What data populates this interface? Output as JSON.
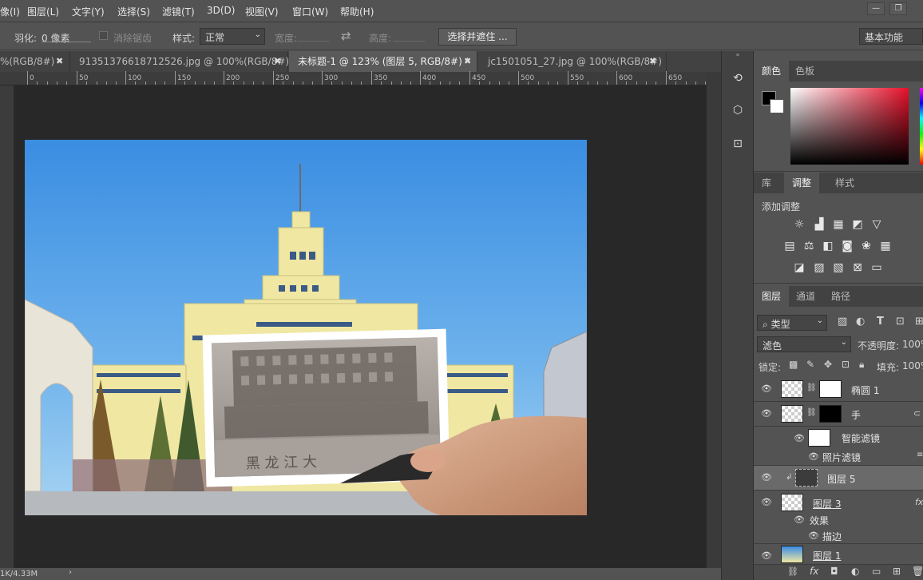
{
  "menu": [
    "像(I)",
    "图层(L)",
    "文字(Y)",
    "选择(S)",
    "滤镜(T)",
    "3D(D)",
    "视图(V)",
    "窗口(W)",
    "帮助(H)"
  ],
  "window_buttons": [
    "—",
    "❐"
  ],
  "options": {
    "feather_label": "羽化:",
    "feather_value": "0 像素",
    "antialias_label": "消除锯齿",
    "style_label": "样式:",
    "style_value": "正常",
    "width_label": "宽度:",
    "height_label": "高度:",
    "select_mask_button": "选择并遮住 ...",
    "workspace": "基本功能"
  },
  "tabs": [
    {
      "label": "%(RGB/8#)"
    },
    {
      "label": "913513766187 12526.jpg @ 100%(RGB/8#)"
    },
    {
      "label": "未标题-1 @ 123% (图层 5, RGB/8#) *"
    },
    {
      "label": "jc1501051_27.jpg @ 100%(RGB/8#)"
    }
  ],
  "ruler_labels": [
    "0",
    "50",
    "100",
    "150",
    "200",
    "250",
    "300",
    "350",
    "400",
    "450",
    "500",
    "550",
    "600",
    "650"
  ],
  "status": {
    "doc_size": "1K/4.33M",
    "arrow": "›"
  },
  "color_panel": {
    "tabs": [
      "颜色",
      "色板"
    ],
    "accent": "#e8102a"
  },
  "adjust_panel": {
    "tabs": [
      "库",
      "调整",
      "样式"
    ],
    "heading": "添加调整"
  },
  "layers_panel": {
    "tabs": [
      "图层",
      "通道",
      "路径"
    ],
    "filter_label": "类型",
    "blend_mode": "滤色",
    "opacity_label": "不透明度:",
    "opacity_value": "100%",
    "lock_label": "锁定:",
    "fill_label": "填充:",
    "fill_value": "100%",
    "layers": [
      {
        "name": "椭圆 1"
      },
      {
        "name": "手"
      },
      {
        "name": "智能滤镜"
      },
      {
        "name": "照片滤镜"
      },
      {
        "name": "图层 5"
      },
      {
        "name": "图层 3"
      },
      {
        "name": "效果"
      },
      {
        "name": "描边"
      },
      {
        "name": "图层 1"
      }
    ],
    "fx_label": "fx"
  },
  "canvas_text": "黑 龙 江 大"
}
